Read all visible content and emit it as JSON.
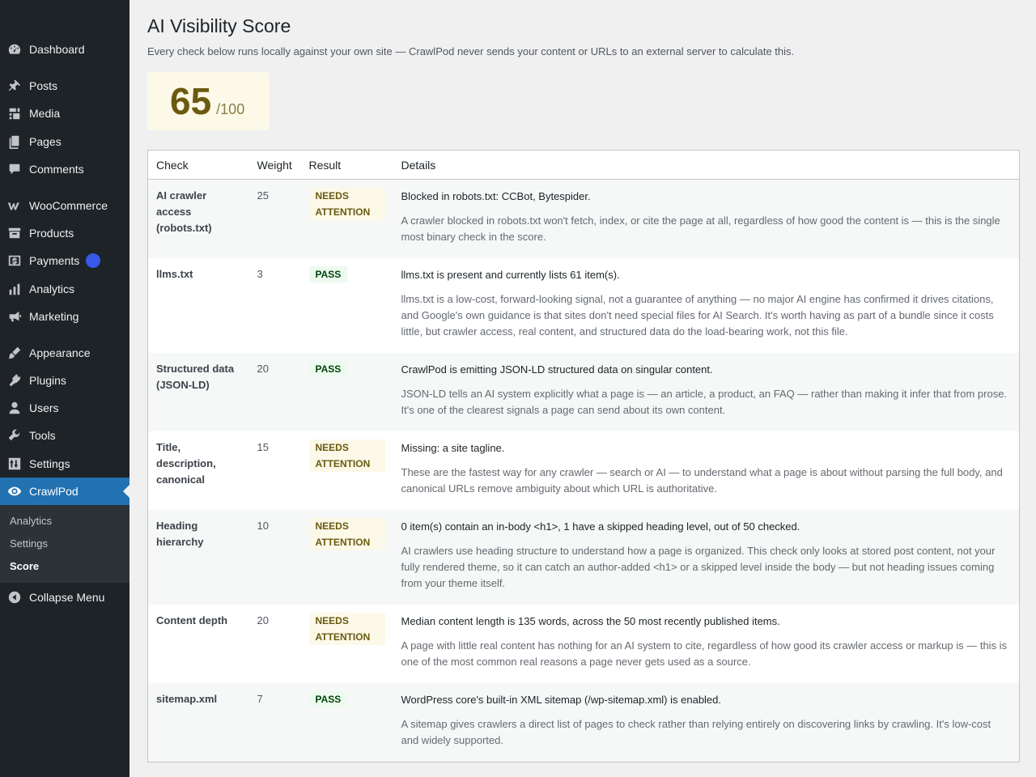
{
  "sidebar": {
    "items": [
      {
        "label": "Dashboard",
        "icon": "dashboard-icon"
      },
      {
        "label": "Posts",
        "icon": "pin-icon"
      },
      {
        "label": "Media",
        "icon": "media-icon"
      },
      {
        "label": "Pages",
        "icon": "pages-icon"
      },
      {
        "label": "Comments",
        "icon": "comment-icon"
      },
      {
        "label": "WooCommerce",
        "icon": "woo-icon"
      },
      {
        "label": "Products",
        "icon": "archive-icon"
      },
      {
        "label": "Payments",
        "icon": "dollar-icon"
      },
      {
        "label": "Analytics",
        "icon": "bar-chart-icon"
      },
      {
        "label": "Marketing",
        "icon": "megaphone-icon"
      },
      {
        "label": "Appearance",
        "icon": "brush-icon"
      },
      {
        "label": "Plugins",
        "icon": "plug-icon"
      },
      {
        "label": "Users",
        "icon": "user-icon"
      },
      {
        "label": "Tools",
        "icon": "wrench-icon"
      },
      {
        "label": "Settings",
        "icon": "sliders-icon"
      },
      {
        "label": "CrawlPod",
        "icon": "eye-icon"
      }
    ],
    "submenu": [
      "Analytics",
      "Settings",
      "Score"
    ],
    "collapse_label": "Collapse Menu"
  },
  "page": {
    "title": "AI Visibility Score",
    "description": "Every check below runs locally against your own site — CrawlPod never sends your content or URLs to an external server to calculate this."
  },
  "score": {
    "value": "65",
    "max": "/100"
  },
  "table": {
    "headers": [
      "Check",
      "Weight",
      "Result",
      "Details"
    ],
    "rows": [
      {
        "check": "AI crawler access (robots.txt)",
        "weight": "25",
        "result": "NEEDS ATTENTION",
        "detail": "Blocked in robots.txt: CCBot, Bytespider.",
        "note": "A crawler blocked in robots.txt won't fetch, index, or cite the page at all, regardless of how good the content is — this is the single most binary check in the score."
      },
      {
        "check": "llms.txt",
        "weight": "3",
        "result": "PASS",
        "detail": "llms.txt is present and currently lists 61 item(s).",
        "note": "llms.txt is a low-cost, forward-looking signal, not a guarantee of anything — no major AI engine has confirmed it drives citations, and Google's own guidance is that sites don't need special files for AI Search. It's worth having as part of a bundle since it costs little, but crawler access, real content, and structured data do the load-bearing work, not this file."
      },
      {
        "check": "Structured data (JSON-LD)",
        "weight": "20",
        "result": "PASS",
        "detail": "CrawlPod is emitting JSON-LD structured data on singular content.",
        "note": "JSON-LD tells an AI system explicitly what a page is — an article, a product, an FAQ — rather than making it infer that from prose. It's one of the clearest signals a page can send about its own content."
      },
      {
        "check": "Title, description, canonical",
        "weight": "15",
        "result": "NEEDS ATTENTION",
        "detail": "Missing: a site tagline.",
        "note": "These are the fastest way for any crawler — search or AI — to understand what a page is about without parsing the full body, and canonical URLs remove ambiguity about which URL is authoritative."
      },
      {
        "check": "Heading hierarchy",
        "weight": "10",
        "result": "NEEDS ATTENTION",
        "detail": "0 item(s) contain an in-body <h1>, 1 have a skipped heading level, out of 50 checked.",
        "note": "AI crawlers use heading structure to understand how a page is organized. This check only looks at stored post content, not your fully rendered theme, so it can catch an author-added <h1> or a skipped level inside the body — but not heading issues coming from your theme itself."
      },
      {
        "check": "Content depth",
        "weight": "20",
        "result": "NEEDS ATTENTION",
        "detail": "Median content length is 135 words, across the 50 most recently published items.",
        "note": "A page with little real content has nothing for an AI system to cite, regardless of how good its crawler access or markup is — this is one of the most common real reasons a page never gets used as a source."
      },
      {
        "check": "sitemap.xml",
        "weight": "7",
        "result": "PASS",
        "detail": "WordPress core's built-in XML sitemap (/wp-sitemap.xml) is enabled.",
        "note": "A sitemap gives crawlers a direct list of pages to check rather than relying entirely on discovering links by crawling. It's low-cost and widely supported."
      }
    ]
  }
}
